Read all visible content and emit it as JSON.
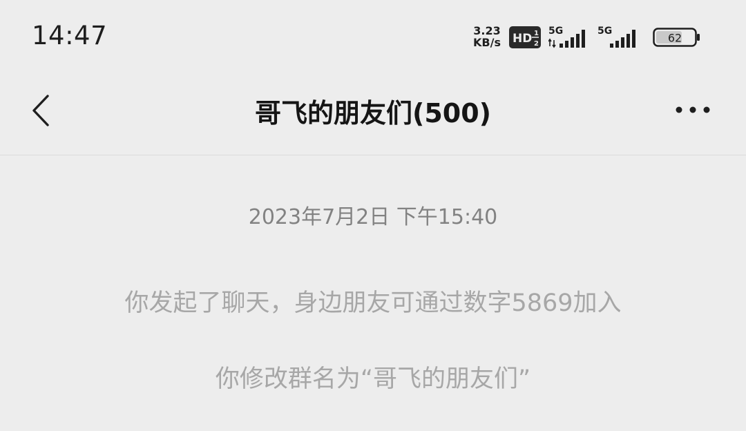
{
  "status_bar": {
    "time": "14:47",
    "net_speed_value": "3.23",
    "net_speed_unit": "KB/s",
    "hd_label": "HD",
    "sim1_label": "5G",
    "sim2_label": "5G",
    "battery_level": "62"
  },
  "nav": {
    "back_icon": "chevron-left-icon",
    "title": "哥飞的朋友们(500)",
    "more_icon": "more-dots-icon"
  },
  "chat": {
    "timestamp": "2023年7月2日 下午15:40",
    "messages": [
      "你发起了聊天，身边朋友可通过数字5869加入",
      "你修改群名为“哥飞的朋友们”"
    ]
  }
}
